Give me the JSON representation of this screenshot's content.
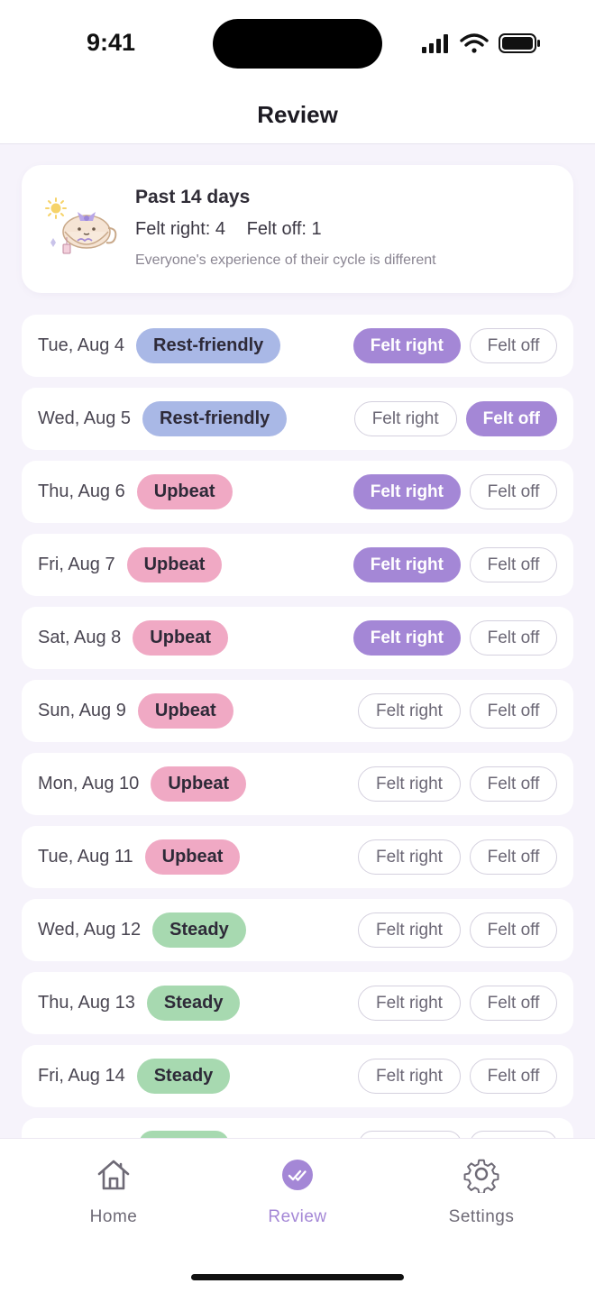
{
  "status_bar": {
    "time": "9:41"
  },
  "header": {
    "title": "Review"
  },
  "summary": {
    "title": "Past 14 days",
    "felt_right": "Felt right: 4",
    "felt_off": "Felt off: 1",
    "note": "Everyone's experience of their cycle is different"
  },
  "rows": [
    {
      "date": "Tue, Aug 4",
      "tag": "Rest-friendly",
      "tag_kind": "rest",
      "selected": "right",
      "right_label": "Felt right",
      "off_label": "Felt off"
    },
    {
      "date": "Wed, Aug 5",
      "tag": "Rest-friendly",
      "tag_kind": "rest",
      "selected": "off",
      "right_label": "Felt right",
      "off_label": "Felt off"
    },
    {
      "date": "Thu, Aug 6",
      "tag": "Upbeat",
      "tag_kind": "upbeat",
      "selected": "right",
      "right_label": "Felt right",
      "off_label": "Felt off"
    },
    {
      "date": "Fri, Aug 7",
      "tag": "Upbeat",
      "tag_kind": "upbeat",
      "selected": "right",
      "right_label": "Felt right",
      "off_label": "Felt off"
    },
    {
      "date": "Sat, Aug 8",
      "tag": "Upbeat",
      "tag_kind": "upbeat",
      "selected": "right",
      "right_label": "Felt right",
      "off_label": "Felt off"
    },
    {
      "date": "Sun, Aug 9",
      "tag": "Upbeat",
      "tag_kind": "upbeat",
      "selected": "none",
      "right_label": "Felt right",
      "off_label": "Felt off"
    },
    {
      "date": "Mon, Aug 10",
      "tag": "Upbeat",
      "tag_kind": "upbeat",
      "selected": "none",
      "right_label": "Felt right",
      "off_label": "Felt off"
    },
    {
      "date": "Tue, Aug 11",
      "tag": "Upbeat",
      "tag_kind": "upbeat",
      "selected": "none",
      "right_label": "Felt right",
      "off_label": "Felt off"
    },
    {
      "date": "Wed, Aug 12",
      "tag": "Steady",
      "tag_kind": "steady",
      "selected": "none",
      "right_label": "Felt right",
      "off_label": "Felt off"
    },
    {
      "date": "Thu, Aug 13",
      "tag": "Steady",
      "tag_kind": "steady",
      "selected": "none",
      "right_label": "Felt right",
      "off_label": "Felt off"
    },
    {
      "date": "Fri, Aug 14",
      "tag": "Steady",
      "tag_kind": "steady",
      "selected": "none",
      "right_label": "Felt right",
      "off_label": "Felt off"
    }
  ],
  "tab_bar": {
    "home": {
      "label": "Home",
      "icon": "home-icon"
    },
    "review": {
      "label": "Review",
      "icon": "review-check-icon"
    },
    "settings": {
      "label": "Settings",
      "icon": "gear-icon"
    }
  },
  "colors": {
    "accent": "#a487d6",
    "rest": "#a9b8e6",
    "upbeat": "#f0a9c4",
    "steady": "#a7d9b0",
    "background": "#f6f3fb"
  }
}
